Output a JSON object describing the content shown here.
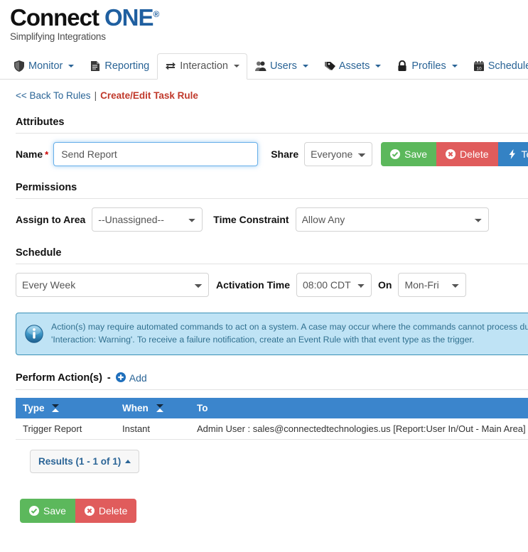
{
  "brand": {
    "name_part1": "Connect",
    "name_part2": "ONE",
    "registered": "®",
    "tagline": "Simplifying Integrations",
    "color_dark": "#111111",
    "color_blue": "#1f5fa0"
  },
  "nav": {
    "items": [
      {
        "label": "Monitor",
        "icon": "shield-icon",
        "caret": true,
        "active": false
      },
      {
        "label": "Reporting",
        "icon": "report-icon",
        "caret": false,
        "active": false
      },
      {
        "label": "Interaction",
        "icon": "exchange-icon",
        "caret": true,
        "active": true
      },
      {
        "label": "Users",
        "icon": "users-icon",
        "caret": true,
        "active": false
      },
      {
        "label": "Assets",
        "icon": "tags-icon",
        "caret": true,
        "active": false
      },
      {
        "label": "Profiles",
        "icon": "lock-icon",
        "caret": true,
        "active": false
      },
      {
        "label": "Schedules",
        "icon": "calendar-icon",
        "caret": true,
        "active": false
      }
    ]
  },
  "breadcrumb": {
    "back_label": "<< Back To Rules",
    "separator": "|",
    "current": "Create/Edit Task Rule"
  },
  "sections": {
    "attributes": "Attributes",
    "permissions": "Permissions",
    "schedule": "Schedule"
  },
  "attributes": {
    "name_label": "Name",
    "required_marker": "*",
    "name_value": "Send Report",
    "name_placeholder": "Send Report",
    "share_label": "Share",
    "share_value": "Everyone",
    "share_options": [
      "Everyone"
    ],
    "buttons": {
      "save": "Save",
      "delete": "Delete",
      "test": "Test",
      "save_color": "#5cb85c",
      "delete_color": "#e05c5c",
      "test_color": "#3482c4"
    }
  },
  "permissions": {
    "area_label": "Assign to Area",
    "area_value": "--Unassigned--",
    "area_options": [
      "--Unassigned--"
    ],
    "time_label": "Time Constraint",
    "time_value": "Allow Any",
    "time_options": [
      "Allow Any"
    ]
  },
  "schedule": {
    "frequency_value": "Every Week",
    "frequency_options": [
      "Every Week"
    ],
    "activation_label": "Activation Time",
    "activation_value": "08:00 CDT",
    "activation_options": [
      "08:00 CDT"
    ],
    "on_label": "On",
    "on_value": "Mon-Fri",
    "on_options": [
      "Mon-Fri"
    ]
  },
  "alert": {
    "icon": "info-icon",
    "text": "Action(s) may require automated commands to act on a system. A case may occur where the commands cannot process due to the system state. This will process with the Event Type 'Interaction: Warning'. To receive a failure notification, create an Event Rule with that event type as the trigger.",
    "bg_color": "#bfe3f5",
    "border_color": "#3a90b5",
    "text_color": "#31708f"
  },
  "perform_actions": {
    "title": "Perform Action(s)",
    "dash": "-",
    "add_label": "Add",
    "table": {
      "columns": [
        "Type",
        "When",
        "To"
      ],
      "header_color": "#3b85cc",
      "rows": [
        {
          "type": "Trigger Report",
          "when": "Instant",
          "to": "Admin User : sales@connectedtechnologies.us [Report:User In/Out - Main Area]"
        }
      ]
    },
    "results_label": "Results (1 - 1 of 1)"
  },
  "bottom_buttons": {
    "save": "Save",
    "delete": "Delete"
  }
}
